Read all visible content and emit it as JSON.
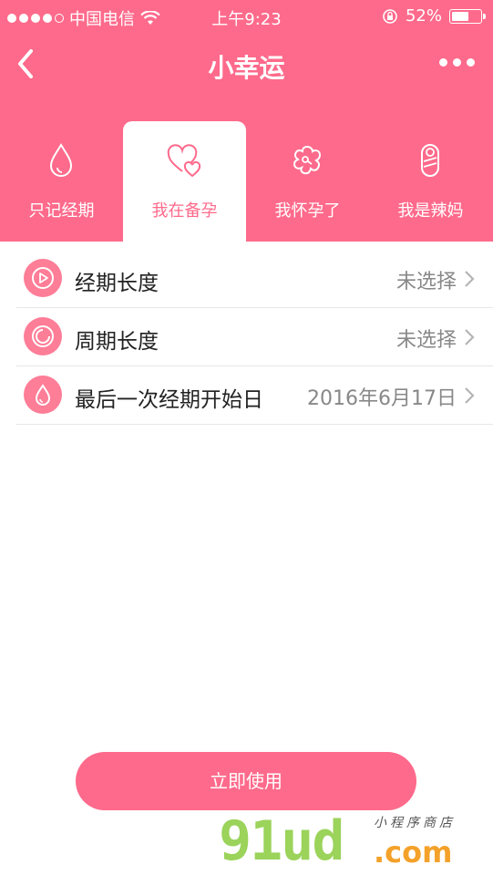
{
  "status_bar": {
    "carrier": "中国电信",
    "time": "上午9:23",
    "battery_percent": "52%"
  },
  "nav": {
    "title": "小幸运"
  },
  "tabs": [
    {
      "label": "只记经期",
      "icon": "drop-icon",
      "active": false
    },
    {
      "label": "我在备孕",
      "icon": "hearts-icon",
      "active": true
    },
    {
      "label": "我怀孕了",
      "icon": "flower-icon",
      "active": false
    },
    {
      "label": "我是辣妈",
      "icon": "baby-icon",
      "active": false
    }
  ],
  "settings": [
    {
      "label": "经期长度",
      "value": "未选择",
      "icon": "play-circle-icon"
    },
    {
      "label": "周期长度",
      "value": "未选择",
      "icon": "cycle-icon"
    },
    {
      "label": "最后一次经期开始日",
      "value": "2016年6月17日",
      "icon": "drop-icon"
    }
  ],
  "use_button": "立即使用",
  "watermark": {
    "main": "91ud",
    "com": ".com",
    "sub": "小程序商店"
  },
  "colors": {
    "accent": "#fe6a8b",
    "icon_bg": "#fe7d97"
  }
}
